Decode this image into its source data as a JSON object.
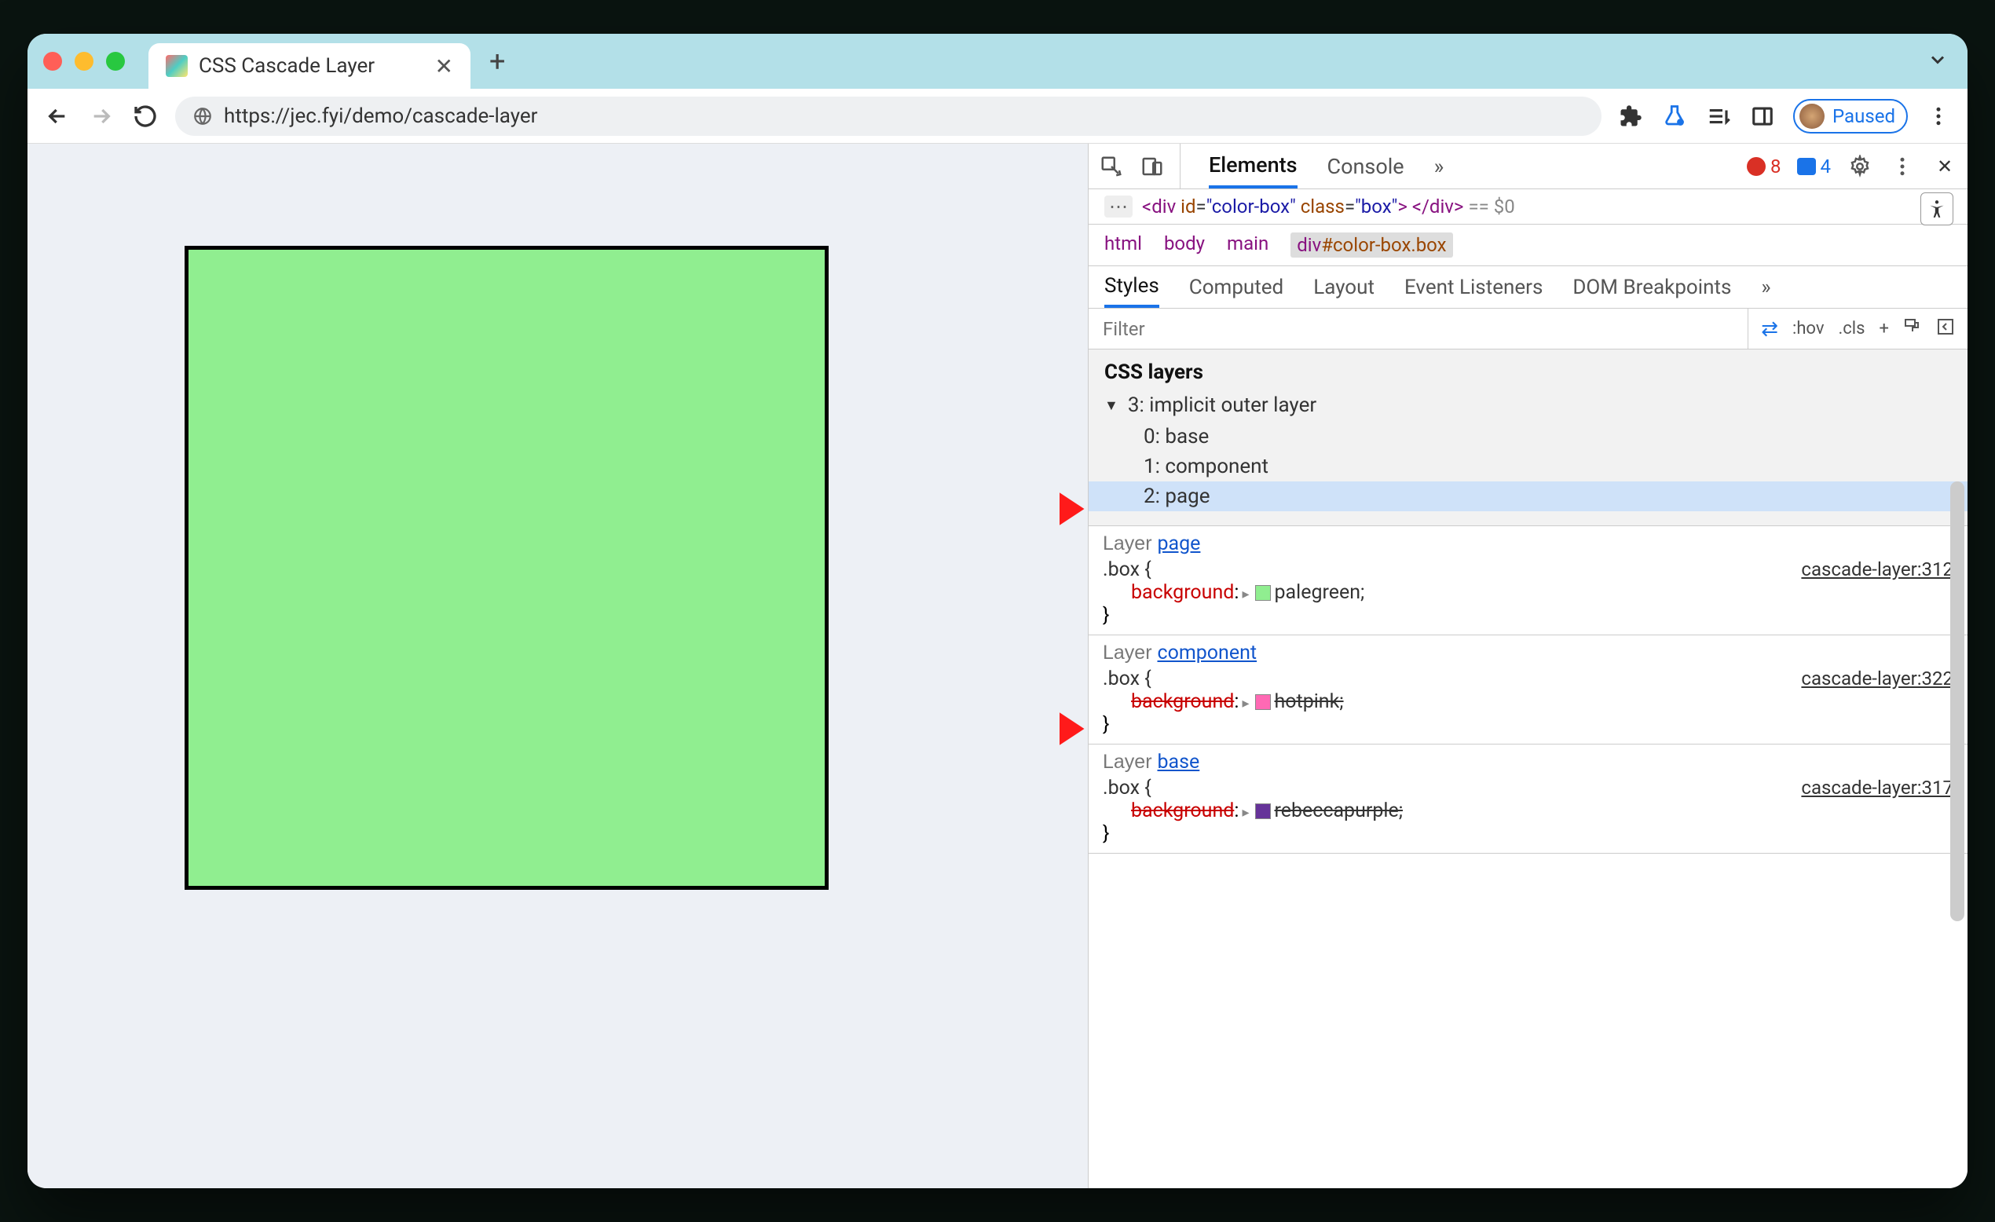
{
  "browser": {
    "tab_title": "CSS Cascade Layer",
    "url": "https://jec.fyi/demo/cascade-layer",
    "paused_label": "Paused"
  },
  "devtools": {
    "tabs": {
      "elements": "Elements",
      "console": "Console"
    },
    "errors": "8",
    "messages": "4",
    "dom_line": {
      "tag_open": "<div",
      "id_attr": "id",
      "id_val": "\"color-box\"",
      "class_attr": "class",
      "class_val": "\"box\"",
      "tag_close_open": ">",
      "tag_end": "</div>",
      "eq_suffix": "== $0"
    },
    "breadcrumb": [
      "html",
      "body",
      "main"
    ],
    "breadcrumb_selected": "div#color-box.box",
    "styles_tabs": {
      "styles": "Styles",
      "computed": "Computed",
      "layout": "Layout",
      "event_listeners": "Event Listeners",
      "dom_breakpoints": "DOM Breakpoints"
    },
    "filter_placeholder": "Filter",
    "filter_actions": {
      "hov": ":hov",
      "cls": ".cls",
      "plus": "+"
    },
    "layers": {
      "title": "CSS layers",
      "parent": "3: implicit outer layer",
      "children": [
        "0: base",
        "1: component",
        "2: page"
      ],
      "selected_index": 2
    },
    "style_blocks": [
      {
        "layer_prefix": "Layer ",
        "layer_link": "page",
        "selector": ".box {",
        "source": "cascade-layer:312",
        "prop": "background",
        "value": "palegreen",
        "swatch": "#90ee90",
        "overridden": false
      },
      {
        "layer_prefix": "Layer ",
        "layer_link": "component",
        "selector": ".box {",
        "source": "cascade-layer:322",
        "prop": "background",
        "value": "hotpink",
        "swatch": "#ff69b4",
        "overridden": true
      },
      {
        "layer_prefix": "Layer ",
        "layer_link": "base",
        "selector": ".box {",
        "source": "cascade-layer:317",
        "prop": "background",
        "value": "rebeccapurple",
        "swatch": "#663399",
        "overridden": true
      }
    ],
    "colon": ":",
    "semicolon": ";",
    "close_brace": "}"
  }
}
